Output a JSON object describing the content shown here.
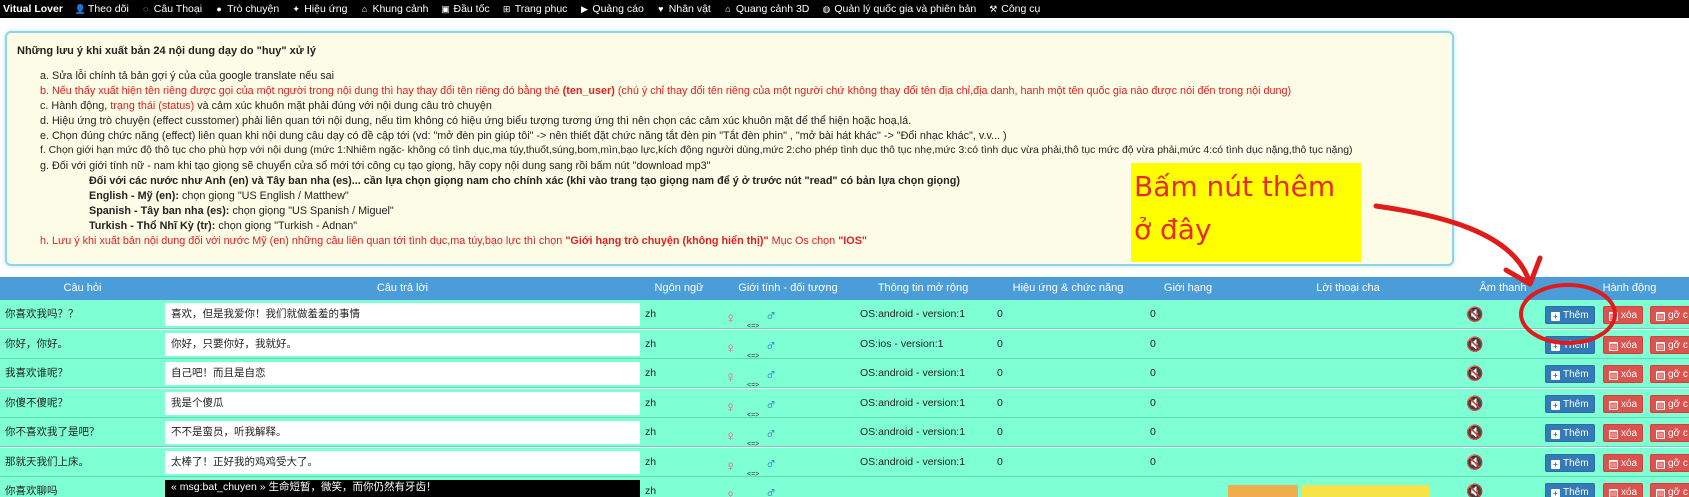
{
  "nav": {
    "brand": "Vitual Lover",
    "items": [
      {
        "icon": "user-icon",
        "label": "Theo dõi"
      },
      {
        "icon": "comment-icon",
        "label": "Câu Thoại"
      },
      {
        "icon": "comments-icon",
        "label": "Trò chuyện"
      },
      {
        "icon": "magic-icon",
        "label": "Hiệu ứng"
      },
      {
        "icon": "bank-icon",
        "label": "Khung cảnh"
      },
      {
        "icon": "briefcase-icon",
        "label": "Đầu tốc"
      },
      {
        "icon": "cart-icon",
        "label": "Trang phục"
      },
      {
        "icon": "play-circle-icon",
        "label": "Quảng cáo"
      },
      {
        "icon": "heart-icon",
        "label": "Nhân vật"
      },
      {
        "icon": "bank-icon",
        "label": "Quang cảnh 3D"
      },
      {
        "icon": "globe-icon",
        "label": "Quản lý quốc gia và phiên bản"
      },
      {
        "icon": "tools-icon",
        "label": "Công cụ"
      }
    ]
  },
  "notes": {
    "title": "Những lưu ý khi xuất bản 24 nội dung dạy do \"huy\" xử lý",
    "a": "a. Sửa lỗi chính tả bản gợi ý của của google translate nếu sai",
    "b_pre": "b. Nếu thấy xuất hiện tên riêng được gọi của một người trong nội dung thì hay thay đổi tên riêng đó bằng thẻ ",
    "b_tag": "(ten_user)",
    "b_post": " (chú ý chỉ thay đổi tên riêng của một người chứ không thay đổi tên địa chỉ,địa danh, hanh một tên quốc gia nào được nói đến trong nội dung)",
    "c_pre": "c. Hành động, ",
    "c_red": "trạng thái (status)",
    "c_post": " và cảm xúc khuôn mặt phải đúng với nội dung câu trò chuyện",
    "d": "d. Hiệu ứng trò chuyện (effect cusstomer) phải liên quan tới nội dung, nếu tìm không có hiệu ứng biểu tượng tương ứng thì nên chọn các cảm xúc khuôn mặt để thể hiện hoặc hoạ,lá.",
    "e": "e. Chọn đúng chức năng (effect) liên quan khi nội dung câu dạy có đề cập tới (vd: \"mở đèn pin giúp tôi\" -> nên thiết đặt chức năng tắt đèn pin \"Tắt đèn phin\" , \"mở bài hát khác\" -> \"Đổi nhạc khác\", v.v... )",
    "f": "f. Chọn giới hạn mức độ thô tục cho phù hợp với nội dung (mức 1:Nhiêm ngặc- không có tình dục,ma túy,thuốt,súng,bom,mìn,bạo lực,kích động người dùng,mức 2:cho phép tình dục thô tục nhẹ,mức 3:có tình dục vừa phải,thô tục mức độ vừa phải,mức 4:có tình dục nặng,thô tục nặng)",
    "g": "g. Đối với giới tính nữ - nam khi tạo giọng sẽ chuyển cửa sổ mới tới công cụ tạo giọng, hãy copy nội dung sang rồi bấm nút \"download mp3\"",
    "g1": "Đối với các nước như Anh (en) và Tây ban nha (es)... cần lựa chọn giọng nam cho chính xác (khi vào trang tạo giọng nam để ý ở trước nút \"read\" có bản lựa chọn giọng)",
    "g2_b": "English - Mỹ (en):",
    "g2": " chọn giọng \"US English / Matthew\"",
    "g3_b": "Spanish - Tây ban nha (es):",
    "g3": " chọn giọng \"US Spanish / Miguel\"",
    "g4_b": "Turkish - Thổ Nhĩ Kỳ (tr):",
    "g4": " chọn giọng \"Turkish - Adnan\"",
    "h_pre": "h. Lưu ý khi xuất bản nội dung đối với nước Mỹ (en) những câu liên quan tới tình dục,ma túy,bạo lực thì chọn ",
    "h_bold": "\"Giới hạng trò chuyện (không hiển thị)\"",
    "h_mid": " Mục Os chọn ",
    "h_ios": "\"IOS\""
  },
  "callout": {
    "line1": "Bấm nút thêm",
    "line2": "ở đây",
    "bg": "#ffff00",
    "color": "#e52b2b"
  },
  "table": {
    "headers": [
      "Câu hỏi",
      "Câu trả lời",
      "Ngôn ngữ",
      "Giới tính - đối tượng",
      "Thông tin mở rộng",
      "Hiệu ứng & chức năng",
      "Giới hạng",
      "Lời thoại cha",
      "Âm thanh",
      "Hành động"
    ],
    "gender_mid": "<=>",
    "actions": {
      "add": "Thêm",
      "delete": "xóa",
      "unlink": "gỡ c"
    },
    "rows": [
      {
        "q": "你喜欢我吗？？",
        "a": "喜欢，但是我爱你！我们就做羞羞的事情",
        "lang": "zh",
        "info": "OS:android - version:1",
        "effect": "0",
        "limit": "0"
      },
      {
        "q": "你好，你好。",
        "a": "你好，只要你好，我就好。",
        "lang": "zh",
        "info": "OS:ios - version:1",
        "effect": "0",
        "limit": "0"
      },
      {
        "q": "我喜欢谁呢？",
        "a": "自己吧！而且是自恋",
        "lang": "zh",
        "info": "OS:android - version:1",
        "effect": "0",
        "limit": "0"
      },
      {
        "q": "你傻不傻呢？",
        "a": "我是个傻瓜",
        "lang": "zh",
        "info": "OS:android - version:1",
        "effect": "0",
        "limit": "0"
      },
      {
        "q": "你不喜欢我了是吧？",
        "a": "不不是蛮员，听我解释。",
        "lang": "zh",
        "info": "OS:android - version:1",
        "effect": "0",
        "limit": "0"
      },
      {
        "q": "那就天我们上床。",
        "a": "太棒了！正好我的鸡鸡受大了。",
        "lang": "zh",
        "info": "OS:android - version:1",
        "effect": "0",
        "limit": "0"
      },
      {
        "q": "你喜欢聊吗",
        "a": "« msg:bat_chuyen » 生命短暂，微笑，而你仍然有牙齿！",
        "lang": "zh",
        "info": "",
        "effect": "",
        "limit": ""
      }
    ]
  },
  "colors": {
    "navbar": "#000000",
    "header": "#4b9dd9",
    "row": "#7fffd4",
    "add_button": "#337ab7",
    "delete_button": "#d9534f",
    "note_red": "#e02020",
    "annotation": "#e01b1b"
  }
}
